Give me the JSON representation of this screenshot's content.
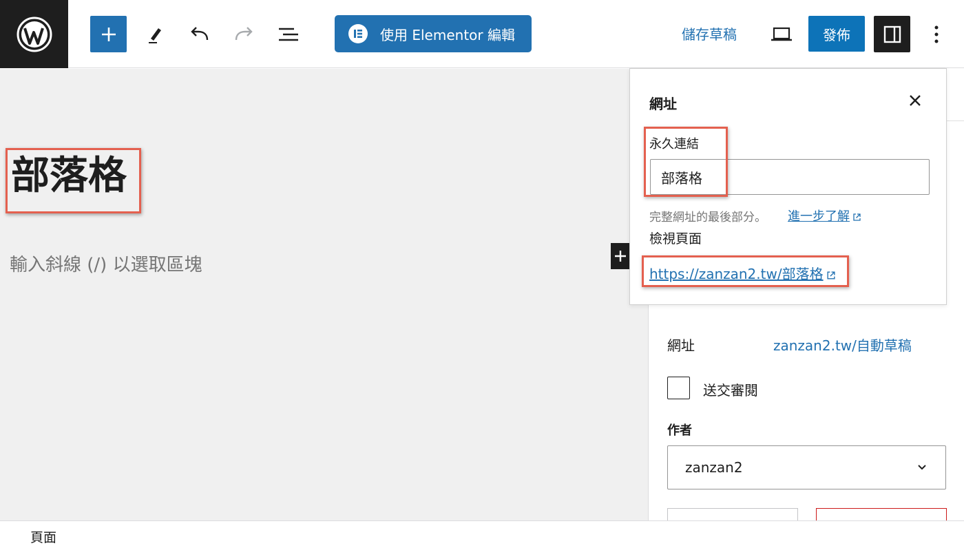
{
  "toolbar": {
    "elementor_label": "使用 Elementor 編輯",
    "save_draft_label": "儲存草稿",
    "publish_label": "發佈",
    "icons": [
      "wordpress-logo",
      "plus",
      "pencil",
      "undo",
      "redo",
      "document-overview",
      "elementor",
      "device-preview",
      "settings-sidebar",
      "more-options"
    ]
  },
  "editor": {
    "post_title": "部落格",
    "block_placeholder": "輸入斜線 (/) 以選取區塊"
  },
  "popover": {
    "title": "網址",
    "permalink_label": "永久連結",
    "permalink_value": "部落格",
    "help_text": "完整網址的最後部分。",
    "learn_more": "進一步了解",
    "view_page_label": "檢視頁面",
    "view_page_url": "https://zanzan2.tw/部落格"
  },
  "sidebar": {
    "url_label": "網址",
    "url_value": "zanzan2.tw/自動草稿",
    "pending_review_label": "送交審閱",
    "author_label": "作者",
    "author_value": "zanzan2"
  },
  "footer": {
    "breadcrumb": "頁面"
  },
  "colors": {
    "accent": "#2271b1",
    "highlight": "#e4604f",
    "dark": "#1e1e1e",
    "canvas": "#f0f0f0"
  }
}
